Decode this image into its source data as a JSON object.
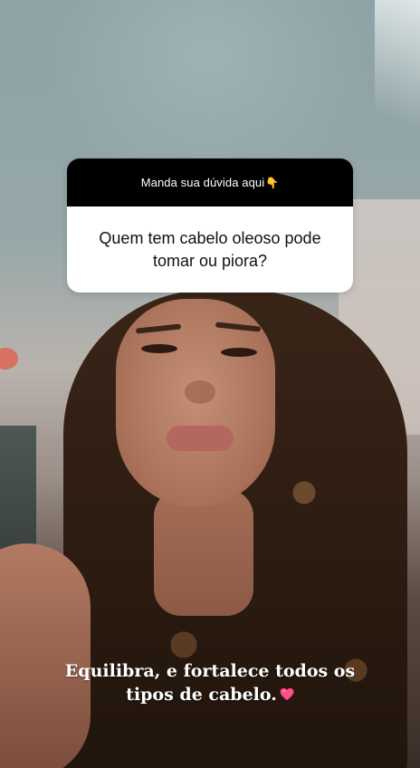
{
  "question_sticker": {
    "prompt": "Manda sua dúvida aqui",
    "prompt_icon": "pointing-down-icon",
    "question": "Quem tem cabelo oleoso pode tomar ou piora?"
  },
  "caption": {
    "text": "Equilibra, e fortalece todos os tipos de cabelo.",
    "icon": "pink-heart-icon"
  },
  "colors": {
    "sticker_header": "#000000",
    "sticker_body": "#ffffff",
    "caption_text": "#ffffff",
    "heart": "#ff4f8b"
  }
}
